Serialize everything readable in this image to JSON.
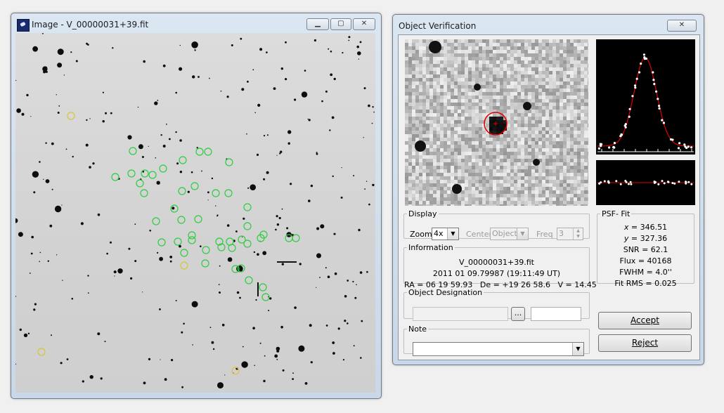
{
  "image_window": {
    "title": "Image - V_00000031+39.fit",
    "buttons": {
      "minimize": "▁",
      "maximize": "▢",
      "close": "✕"
    }
  },
  "verification_window": {
    "title": "Object Verification",
    "close": "✕",
    "display": {
      "legend": "Display",
      "zoom_label": "Zoom",
      "zoom_value": "4x",
      "center_label": "Center",
      "center_value": "Object",
      "freq_label": "Freq",
      "freq_value": "3"
    },
    "information": {
      "legend": "Information",
      "filename": "V_00000031+39.fit",
      "date": "2011 01 09.79987 (19:11:49 UT)",
      "coords": "RA = 06 19 59.93   De = +19 26 58.6   V = 14.45"
    },
    "designation": {
      "legend": "Object Designation",
      "browse_label": "..."
    },
    "note": {
      "legend": "Note"
    },
    "psf_fit": {
      "legend": "PSF- Fit",
      "x_label": "x",
      "x_value": "= 346.51",
      "y_label": "y",
      "y_value": "= 327.36",
      "snr": "SNR = 62.1",
      "flux": "Flux = 40168",
      "fwhm": "FWHM = 4.0''",
      "fit_rms": "Fit RMS = 0.025"
    },
    "accept_label": "Accept",
    "reject_label": "Reject"
  },
  "colors": {
    "detection_marker": "#2ecc40",
    "known_object_marker": "#d9c63a",
    "psf_curve": "#e00000",
    "target_ring": "#e00000"
  }
}
